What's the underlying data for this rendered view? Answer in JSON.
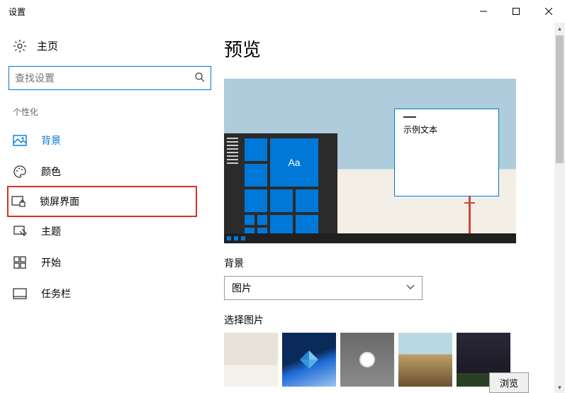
{
  "titlebar": {
    "title": "设置"
  },
  "sidebar": {
    "home": "主页",
    "search_placeholder": "查找设置",
    "section": "个性化",
    "items": [
      {
        "label": "背景"
      },
      {
        "label": "颜色"
      },
      {
        "label": "锁屏界面"
      },
      {
        "label": "主题"
      },
      {
        "label": "开始"
      },
      {
        "label": "任务栏"
      }
    ]
  },
  "content": {
    "heading": "预览",
    "sample_text": "示例文本",
    "aa_text": "Aa",
    "bg_label": "背景",
    "bg_select_value": "图片",
    "choose_label": "选择图片",
    "browse_button": "浏览"
  }
}
